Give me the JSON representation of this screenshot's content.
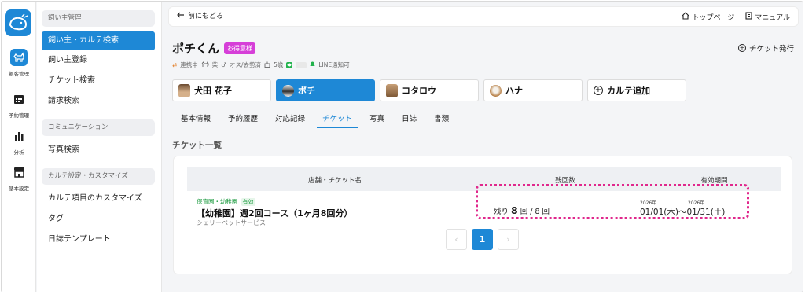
{
  "rail": {
    "items": [
      {
        "label": "顧客管理",
        "icon": "dog-icon",
        "active": true
      },
      {
        "label": "予約管理",
        "icon": "calendar-icon",
        "active": false
      },
      {
        "label": "分析",
        "icon": "bar-chart-icon",
        "active": false
      },
      {
        "label": "基本設定",
        "icon": "store-icon",
        "active": false
      }
    ]
  },
  "sidebar": {
    "sections": [
      {
        "heading": "飼い主管理",
        "items": [
          "飼い主・カルテ検索",
          "飼い主登録",
          "チケット検索",
          "請求検索"
        ]
      },
      {
        "heading": "コミュニケーション",
        "items": [
          "写真検索"
        ]
      },
      {
        "heading": "カルテ設定・カスタマイズ",
        "items": [
          "カルテ項目のカスタマイズ",
          "タグ",
          "日誌テンプレート"
        ]
      }
    ]
  },
  "topbar": {
    "back_label": "前にもどる",
    "top_page_label": "トップページ",
    "manual_label": "マニュアル"
  },
  "pet": {
    "name": "ポチくん",
    "badge": "お得意様",
    "ticket_issue_label": "チケット発行",
    "meta": {
      "linked": "連携中",
      "breed": "柴",
      "sex": "オス/去勢済",
      "age": "5歳",
      "line_notice": "LINE通知可"
    }
  },
  "pet_tabs": [
    {
      "label": "犬田 花子",
      "avatar": "owner-avatar",
      "active": false
    },
    {
      "label": "ポチ",
      "avatar": "dog-avatar",
      "active": true
    },
    {
      "label": "コタロウ",
      "avatar": "dog-avatar",
      "active": false
    },
    {
      "label": "ハナ",
      "avatar": "dog-avatar",
      "active": false
    }
  ],
  "add_karte_label": "カルテ追加",
  "tabs": [
    {
      "label": "基本情報",
      "active": false
    },
    {
      "label": "予約履歴",
      "active": false
    },
    {
      "label": "対応記録",
      "active": false
    },
    {
      "label": "チケット",
      "active": true
    },
    {
      "label": "写真",
      "active": false
    },
    {
      "label": "日誌",
      "active": false
    },
    {
      "label": "書類",
      "active": false
    }
  ],
  "ticket_list": {
    "title": "チケット一覧",
    "columns": [
      "店舗・チケット名",
      "残回数",
      "有効期間"
    ],
    "rows": [
      {
        "category": "保育園・幼稚園",
        "status": "有効",
        "name": "【幼稚園】週2回コース（1ヶ月8回分）",
        "store": "シェリーペットサービス",
        "remain_prefix": "残り",
        "remain": "8",
        "remain_unit": "回",
        "total": "/ 8 回",
        "start_year": "2026年",
        "end_year": "2026年",
        "period": "01/01(木)～01/31(土)"
      }
    ],
    "pagination": {
      "prev": "‹",
      "current": "1",
      "next": "›"
    }
  },
  "colors": {
    "accent": "#1e88d6",
    "vip_badge": "#d63fd8",
    "highlight": "#e0288c",
    "valid": "#1a9a3e"
  }
}
